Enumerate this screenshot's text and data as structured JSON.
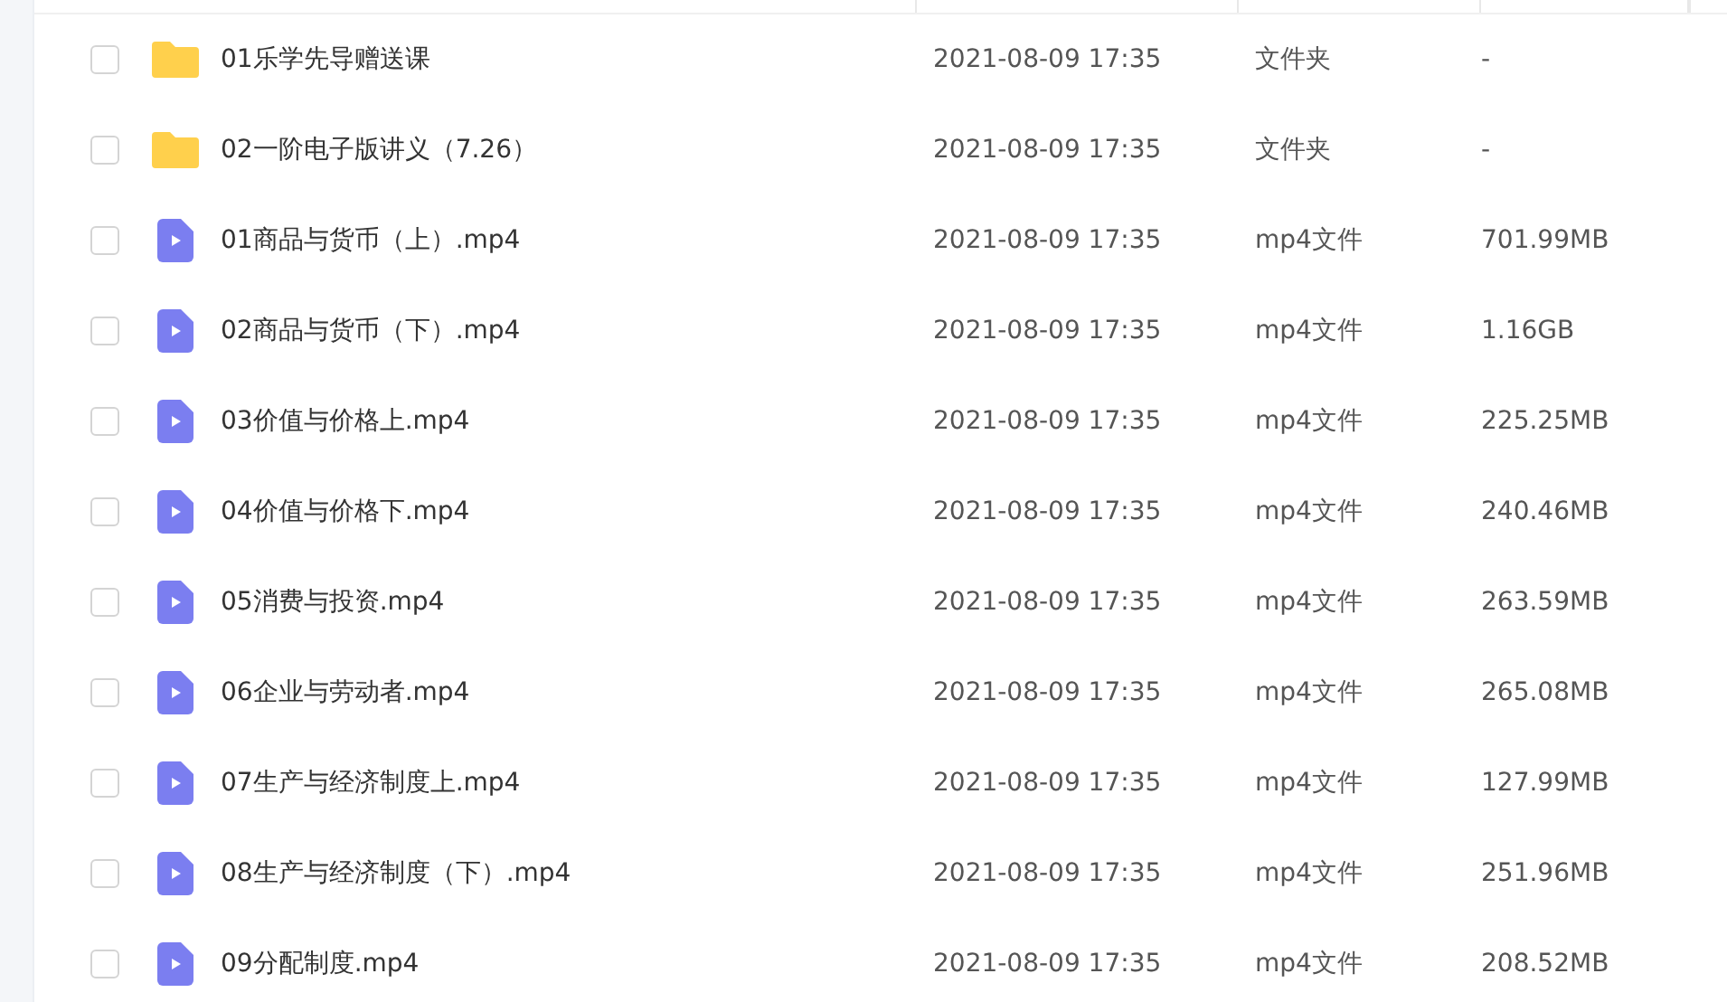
{
  "files": [
    {
      "kind": "folder",
      "checked": false,
      "name": "01乐学先导赠送课",
      "modified": "2021-08-09 17:35",
      "type": "文件夹",
      "size": "-"
    },
    {
      "kind": "folder",
      "checked": false,
      "name": "02一阶电子版讲义（7.26）",
      "modified": "2021-08-09 17:35",
      "type": "文件夹",
      "size": "-"
    },
    {
      "kind": "video",
      "checked": false,
      "name": "01商品与货币（上）.mp4",
      "modified": "2021-08-09 17:35",
      "type": "mp4文件",
      "size": "701.99MB"
    },
    {
      "kind": "video",
      "checked": false,
      "name": "02商品与货币（下）.mp4",
      "modified": "2021-08-09 17:35",
      "type": "mp4文件",
      "size": "1.16GB"
    },
    {
      "kind": "video",
      "checked": false,
      "name": "03价值与价格上.mp4",
      "modified": "2021-08-09 17:35",
      "type": "mp4文件",
      "size": "225.25MB"
    },
    {
      "kind": "video",
      "checked": false,
      "name": "04价值与价格下.mp4",
      "modified": "2021-08-09 17:35",
      "type": "mp4文件",
      "size": "240.46MB"
    },
    {
      "kind": "video",
      "checked": false,
      "name": "05消费与投资.mp4",
      "modified": "2021-08-09 17:35",
      "type": "mp4文件",
      "size": "263.59MB"
    },
    {
      "kind": "video",
      "checked": false,
      "name": "06企业与劳动者.mp4",
      "modified": "2021-08-09 17:35",
      "type": "mp4文件",
      "size": "265.08MB"
    },
    {
      "kind": "video",
      "checked": false,
      "name": "07生产与经济制度上.mp4",
      "modified": "2021-08-09 17:35",
      "type": "mp4文件",
      "size": "127.99MB"
    },
    {
      "kind": "video",
      "checked": false,
      "name": "08生产与经济制度（下）.mp4",
      "modified": "2021-08-09 17:35",
      "type": "mp4文件",
      "size": "251.96MB"
    },
    {
      "kind": "video",
      "checked": false,
      "name": "09分配制度.mp4",
      "modified": "2021-08-09 17:35",
      "type": "mp4文件",
      "size": "208.52MB"
    }
  ]
}
